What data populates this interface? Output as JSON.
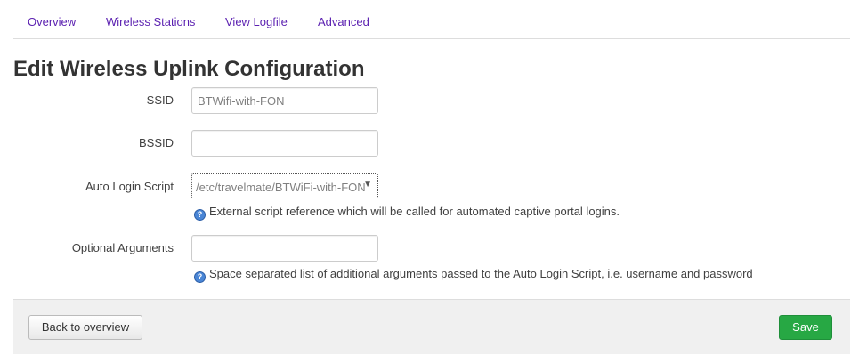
{
  "tabs": {
    "items": [
      {
        "label": "Overview"
      },
      {
        "label": "Wireless Stations"
      },
      {
        "label": "View Logfile"
      },
      {
        "label": "Advanced"
      }
    ]
  },
  "page": {
    "title": "Edit Wireless Uplink Configuration"
  },
  "form": {
    "ssid": {
      "label": "SSID",
      "value": "BTWifi-with-FON"
    },
    "bssid": {
      "label": "BSSID",
      "value": ""
    },
    "auto_login": {
      "label": "Auto Login Script",
      "selected": "/etc/travelmate/BTWiFi-with-FON.login",
      "help": "External script reference which will be called for automated captive portal logins."
    },
    "optional_args": {
      "label": "Optional Arguments",
      "value": "",
      "help": "Space separated list of additional arguments passed to the Auto Login Script, i.e. username and password"
    }
  },
  "actions": {
    "back_label": "Back to overview",
    "save_label": "Save"
  },
  "colors": {
    "link": "#5a1fb0",
    "save": "#27a844",
    "help_icon": "#4a86d6"
  }
}
